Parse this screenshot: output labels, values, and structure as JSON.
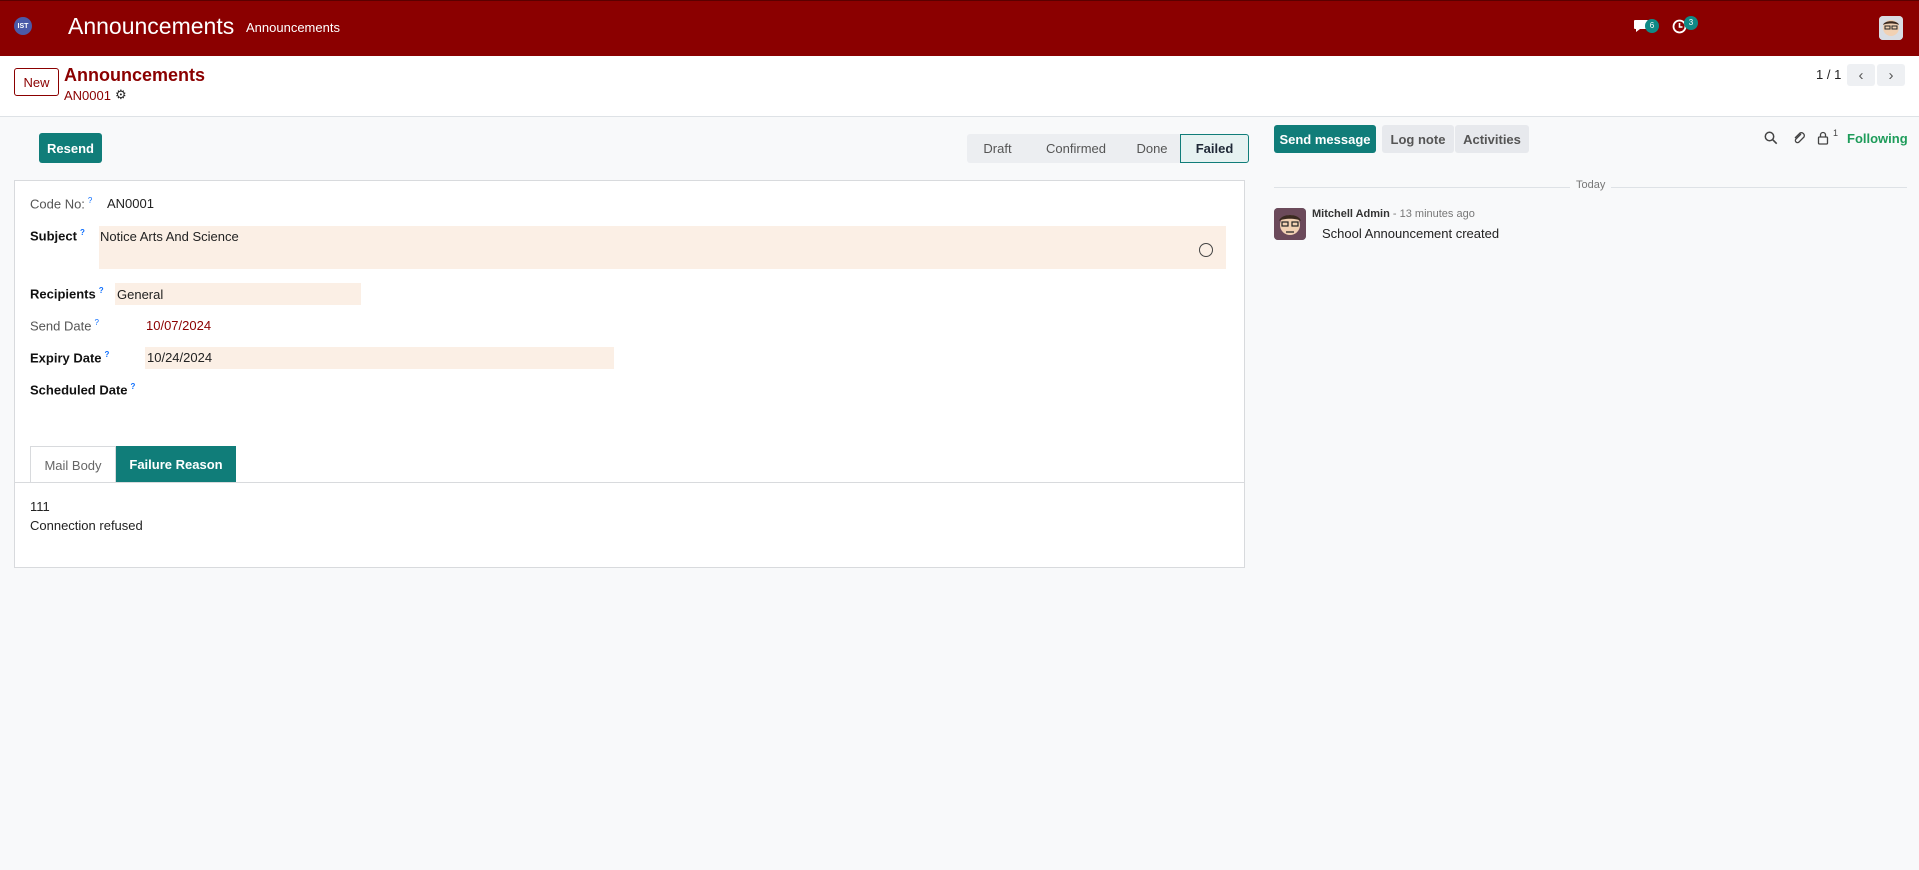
{
  "navbar": {
    "apps_icon_text": "IST",
    "brand": "Announcements",
    "menu": "Announcements",
    "messages_badge": "6",
    "activities_badge": "3"
  },
  "control": {
    "new_label": "New",
    "breadcrumb_parent": "Announcements",
    "breadcrumb_current": "AN0001",
    "pager_value": "1 / 1"
  },
  "header": {
    "resend_label": "Resend",
    "stages": [
      "Draft",
      "Confirmed",
      "Done",
      "Failed"
    ],
    "active_stage": "Failed"
  },
  "form": {
    "code_label": "Code No:",
    "code_value": "AN0001",
    "subject_label": "Subject",
    "subject_value": "Notice Arts And Science",
    "recipients_label": "Recipients",
    "recipients_value": "General",
    "send_date_label": "Send Date",
    "send_date_value": "10/07/2024",
    "expiry_label": "Expiry Date",
    "expiry_value": "10/24/2024",
    "scheduled_label": "Scheduled Date",
    "help_mark": "?",
    "tabs": [
      "Mail Body",
      "Failure Reason"
    ],
    "active_tab": "Failure Reason",
    "failure_code": "111",
    "failure_text": "Connection refused"
  },
  "chatter": {
    "send_message": "Send message",
    "log_note": "Log note",
    "activities": "Activities",
    "followers_count": "1",
    "following": "Following",
    "day_separator": "Today",
    "message": {
      "author": "Mitchell Admin",
      "date": "- 13 minutes ago",
      "body": "School Announcement created"
    }
  },
  "colors": {
    "navbar": "#8b0000",
    "primary": "#107d79",
    "required_field_bg": "#fbefe5",
    "following": "#1e9c5a"
  }
}
